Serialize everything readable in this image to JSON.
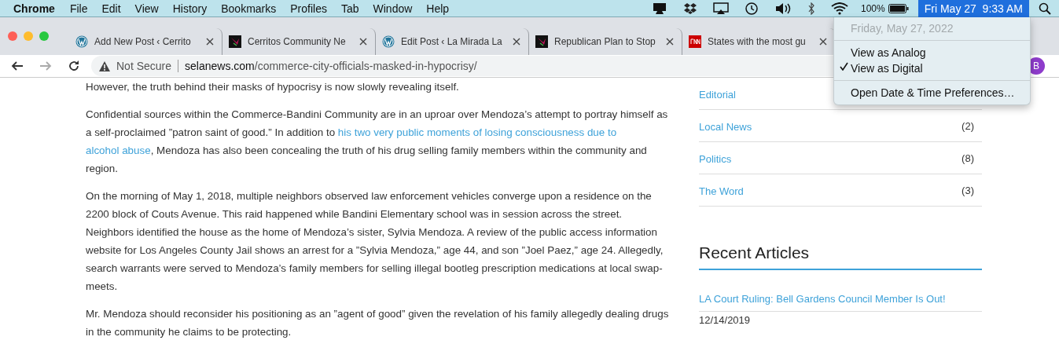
{
  "menubar": {
    "app": "Chrome",
    "items": [
      "File",
      "Edit",
      "View",
      "History",
      "Bookmarks",
      "Profiles",
      "Tab",
      "Window",
      "Help"
    ],
    "battery": "100%",
    "clock": {
      "label": "Fri May 27  9:33 AM",
      "selected": true
    }
  },
  "tabs": [
    {
      "title": "Add New Post ‹ Cerrito",
      "kind": "wordpress",
      "selected": false
    },
    {
      "title": "Cerritos Community Ne",
      "kind": "dark",
      "selected": false
    },
    {
      "title": "Edit Post ‹ La Mirada La",
      "kind": "wordpress",
      "selected": false
    },
    {
      "title": "Republican Plan to Stop",
      "kind": "dark",
      "selected": false
    },
    {
      "title": "States with the most gu",
      "kind": "cnn",
      "selected": false
    }
  ],
  "toolbar": {
    "security": "Not Secure",
    "url_host": "selanews.com",
    "url_path": "/commerce-city-officials-masked-in-hypocrisy/",
    "profile": "B"
  },
  "clock_menu": [
    {
      "kind": "header",
      "label": "Friday, May 27, 2022",
      "disabled": true
    },
    {
      "kind": "separator"
    },
    {
      "kind": "option",
      "label": "View as Analog",
      "checked": false
    },
    {
      "kind": "option",
      "label": "View as Digital",
      "checked": true
    },
    {
      "kind": "separator"
    },
    {
      "kind": "action",
      "label": "Open Date & Time Preferences…"
    }
  ],
  "article": {
    "paragraphs": [
      [
        {
          "text": "However, the truth behind their masks of hypocrisy is now slowly revealing itself."
        }
      ],
      [
        {
          "text": "Confidential sources within the Commerce-Bandini Community are in an uproar over Mendoza’s attempt to portray himself as a self-proclaimed ”patron saint of good.” In addition to "
        },
        {
          "link": "his two very public moments of losing consciousness due to"
        },
        {
          "link": "alcohol abuse"
        },
        {
          "text": ", Mendoza has also been concealing the truth of his drug selling family members within the community and region."
        }
      ],
      [
        {
          "text": "On the morning of May 1, 2018, multiple neighbors observed law enforcement vehicles converge upon a residence on the 2200 block of Couts Avenue. This raid happened while Bandini Elementary school was in session across the street. Neighbors identified the house as the home of Mendoza’s sister, Sylvia Mendoza. A review of the public access information website for Los Angeles County Jail shows an arrest for a ”Sylvia Mendoza,” age 44, and son ”Joel Paez,” age 24. Allegedly, search warrants were served to Mendoza’s family members for selling illegal bootleg prescription medications at local swap-meets."
        }
      ],
      [
        {
          "text": "Mr. Mendoza should reconsider his positioning as an ”agent of good” given the revelation of his family allegedly dealing drugs in the community he claims to be protecting."
        }
      ]
    ]
  },
  "sidebar": {
    "categories": [
      {
        "name": "Editorial"
      },
      {
        "name": "Local News",
        "count": "(2)"
      },
      {
        "name": "Politics",
        "count": "(8)"
      },
      {
        "name": "The Word",
        "count": "(3)"
      }
    ],
    "recent_heading": "Recent Articles",
    "recent": [
      {
        "title": "LA Court Ruling: Bell Gardens Council Member Is Out!",
        "date": "12/14/2019"
      }
    ]
  }
}
